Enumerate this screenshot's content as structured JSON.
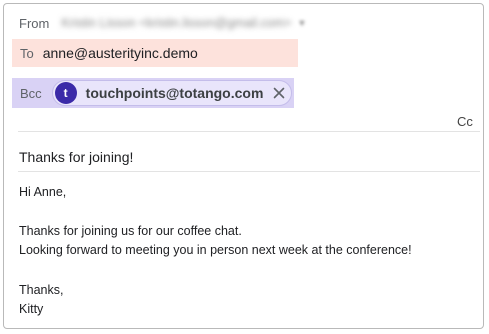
{
  "from": {
    "label": "From",
    "value": "Kristin Lisson <kristin.lisson@gmail.com>"
  },
  "to": {
    "label": "To",
    "value": "anne@austerityinc.demo"
  },
  "bcc": {
    "label": "Bcc",
    "chip": {
      "avatar_letter": "t",
      "email": "touchpoints@totango.com",
      "close_icon": "close-icon"
    }
  },
  "cc_label": "Cc",
  "subject": "Thanks for joining!",
  "body": {
    "greeting": "Hi Anne,",
    "line1": "Thanks for joining us for our coffee chat.",
    "line2": "Looking forward to meeting you in person next week at the conference!",
    "closing": "Thanks,",
    "signature": "Kitty"
  },
  "colors": {
    "to_highlight": "#fde2dc",
    "bcc_highlight": "#d9d2f5",
    "avatar": "#3b2aa8"
  }
}
